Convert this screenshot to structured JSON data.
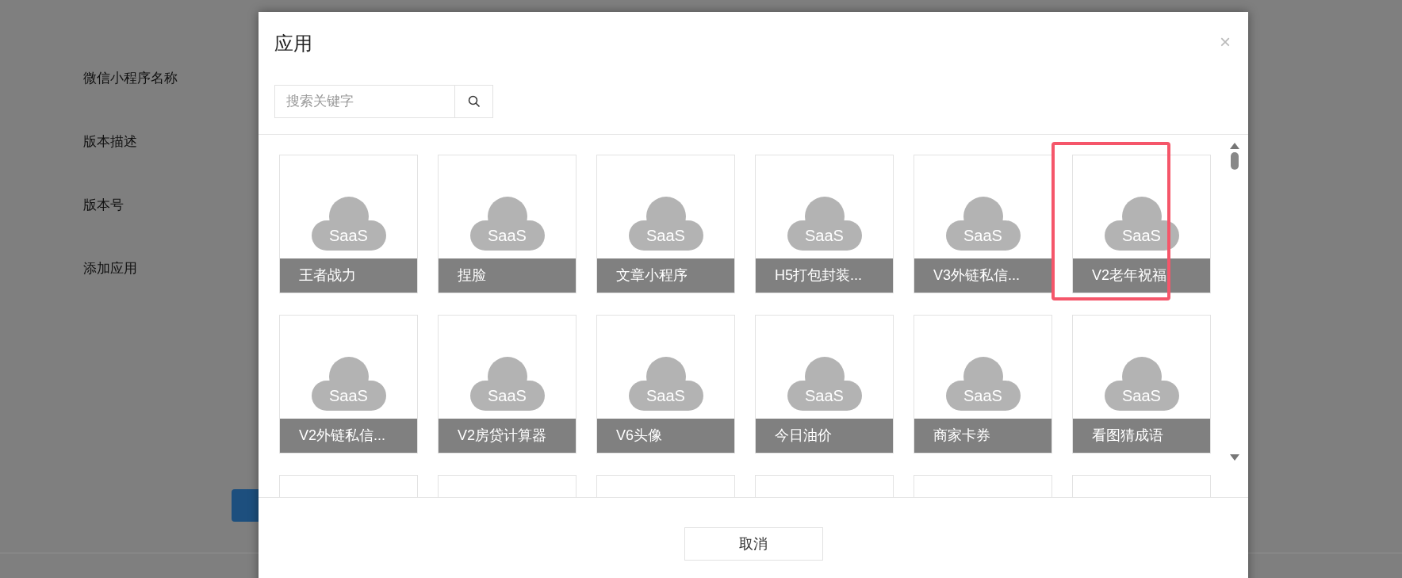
{
  "page": {
    "form_labels": [
      "微信小程序名称",
      "版本描述",
      "版本号",
      "添加应用"
    ]
  },
  "dialog": {
    "title": "应用",
    "close": "×",
    "search": {
      "placeholder": "搜索关键字"
    },
    "apps": [
      {
        "name": "王者战力",
        "logo": "SaaS",
        "selected": false
      },
      {
        "name": "捏脸",
        "logo": "SaaS",
        "selected": false
      },
      {
        "name": "文章小程序",
        "logo": "SaaS",
        "selected": false
      },
      {
        "name": "H5打包封装...",
        "logo": "SaaS",
        "selected": false
      },
      {
        "name": "V3外链私信...",
        "logo": "SaaS",
        "selected": false
      },
      {
        "name": "V2老年祝福",
        "logo": "SaaS",
        "selected": true
      },
      {
        "name": "V2外链私信...",
        "logo": "SaaS",
        "selected": false
      },
      {
        "name": "V2房贷计算器",
        "logo": "SaaS",
        "selected": false
      },
      {
        "name": "V6头像",
        "logo": "SaaS",
        "selected": false
      },
      {
        "name": "今日油价",
        "logo": "SaaS",
        "selected": false
      },
      {
        "name": "商家卡券",
        "logo": "SaaS",
        "selected": false
      },
      {
        "name": "看图猜成语",
        "logo": "SaaS",
        "selected": false
      }
    ],
    "cancel": "取消"
  }
}
